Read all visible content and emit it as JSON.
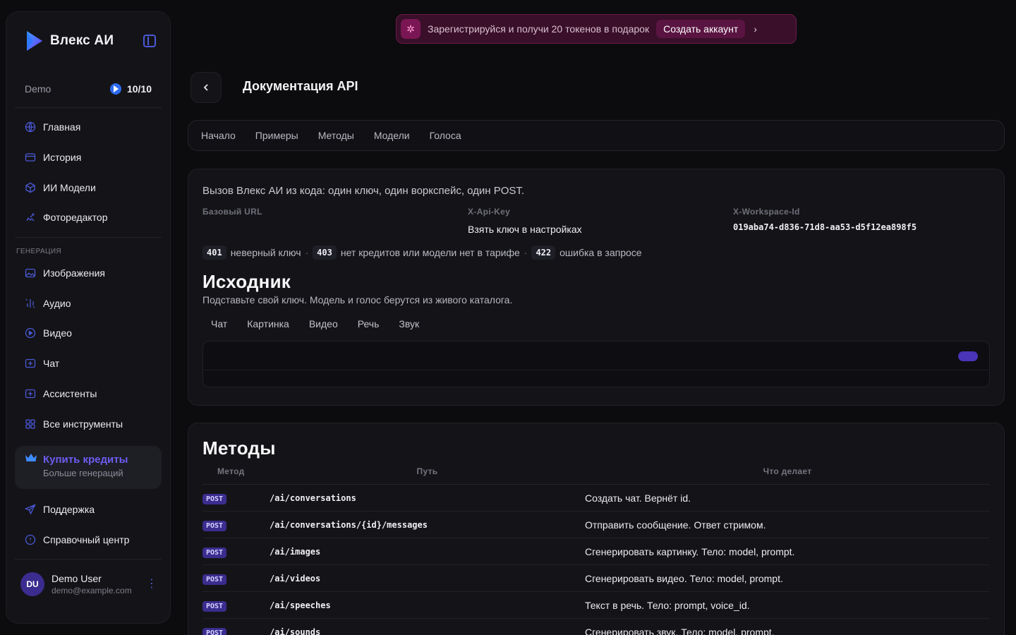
{
  "brand": {
    "name": "Влекс АИ"
  },
  "account": {
    "plan": "Demo",
    "credits": "10/10"
  },
  "nav": {
    "main": [
      {
        "label": "Главная",
        "icon": "globe-icon"
      },
      {
        "label": "История",
        "icon": "history-icon"
      },
      {
        "label": "ИИ Модели",
        "icon": "cube-icon"
      },
      {
        "label": "Фоторедактор",
        "icon": "photo-edit-icon"
      }
    ],
    "section_label": "ГЕНЕРАЦИЯ",
    "generation": [
      {
        "label": "Изображения",
        "icon": "image-icon"
      },
      {
        "label": "Аудио",
        "icon": "audio-icon"
      },
      {
        "label": "Видео",
        "icon": "play-icon"
      },
      {
        "label": "Чат",
        "icon": "chat-icon"
      },
      {
        "label": "Ассистенты",
        "icon": "assistant-icon"
      },
      {
        "label": "Все инструменты",
        "icon": "grid-icon"
      }
    ],
    "buy": {
      "title": "Купить кредиты",
      "subtitle": "Больше генераций"
    },
    "bottom": [
      {
        "label": "Поддержка",
        "icon": "send-icon"
      },
      {
        "label": "Справочный центр",
        "icon": "help-icon"
      }
    ]
  },
  "user": {
    "initials": "DU",
    "name": "Demo User",
    "email": "demo@example.com"
  },
  "promo": {
    "text": "Зарегистрируйся и получи 20 токенов в подарок",
    "button": "Создать аккаунт"
  },
  "page": {
    "title": "Документация API",
    "tabs": [
      "Начало",
      "Примеры",
      "Методы",
      "Модели",
      "Голоса"
    ]
  },
  "api": {
    "intro": "Вызов Влекс АИ из кода: один ключ, один воркспейс, один POST.",
    "base_url_label": "Базовый URL",
    "base_url_value": "",
    "api_key_label": "X-Api-Key",
    "api_key_value": "Взять ключ в настройках",
    "workspace_label": "X-Workspace-Id",
    "workspace_value": "019aba74-d836-71d8-aa53-d5f12ea898f5",
    "errors": [
      {
        "code": "401",
        "text": "неверный ключ"
      },
      {
        "code": "403",
        "text": "нет кредитов или модели нет в тарифе"
      },
      {
        "code": "422",
        "text": "ошибка в запросе"
      }
    ],
    "separator": "·"
  },
  "source": {
    "title": "Исходник",
    "subtitle": "Подставьте свой ключ. Модель и голос берутся из живого каталога.",
    "tabs": [
      "Чат",
      "Картинка",
      "Видео",
      "Речь",
      "Звук"
    ]
  },
  "methods": {
    "title": "Методы",
    "headers": {
      "method": "Метод",
      "path": "Путь",
      "desc": "Что делает"
    },
    "rows": [
      {
        "method": "POST",
        "path": "/ai/conversations",
        "desc": "Создать чат. Вернёт id."
      },
      {
        "method": "POST",
        "path": "/ai/conversations/{id}/messages",
        "desc": "Отправить сообщение. Ответ стримом."
      },
      {
        "method": "POST",
        "path": "/ai/images",
        "desc": "Сгенерировать картинку. Тело: model, prompt."
      },
      {
        "method": "POST",
        "path": "/ai/videos",
        "desc": "Сгенерировать видео. Тело: model, prompt."
      },
      {
        "method": "POST",
        "path": "/ai/speeches",
        "desc": "Текст в речь. Тело: prompt, voice_id."
      },
      {
        "method": "POST",
        "path": "/ai/sounds",
        "desc": "Сгенерировать звук. Тело: model, prompt."
      }
    ]
  },
  "colors": {
    "accent": "#4a58d6",
    "brand_purple": "#6d5cf0",
    "promo_bg": "#3a0f2a"
  }
}
